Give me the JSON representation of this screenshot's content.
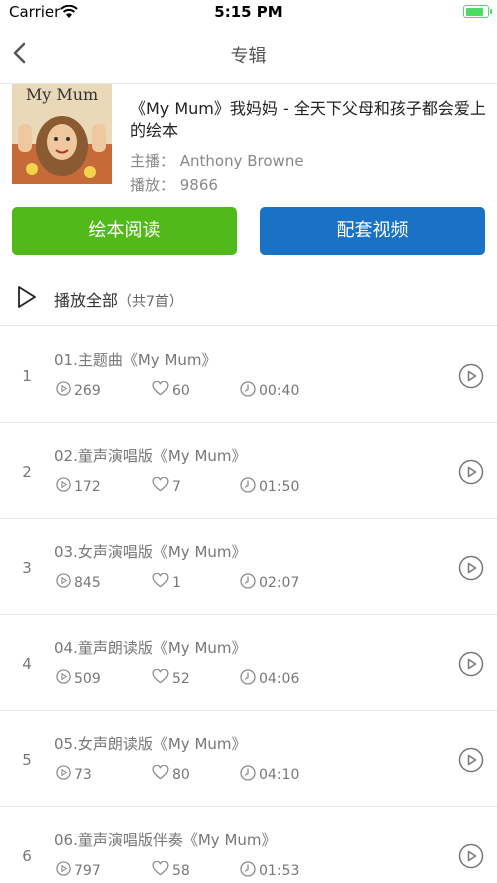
{
  "status_bar": {
    "carrier": "Carrier",
    "time": "5:15 PM"
  },
  "nav": {
    "title": "专辑",
    "back_icon": "chevron-left-icon"
  },
  "album": {
    "cover_text": "My Mum",
    "title": "《My Mum》我妈妈 - 全天下父母和孩子都会爱上的绘本",
    "host": "主播：  Anthony Browne",
    "plays": "播放：  9866"
  },
  "buttons": {
    "read": "绘本阅读",
    "video": "配套视频"
  },
  "play_all": {
    "label": "播放全部",
    "count": "（共7首）"
  },
  "tracks": [
    {
      "num": "1",
      "name": "01.主题曲《My Mum》",
      "plays": "269",
      "likes": "60",
      "duration": "00:40"
    },
    {
      "num": "2",
      "name": "02.童声演唱版《My Mum》",
      "plays": "172",
      "likes": "7",
      "duration": "01:50"
    },
    {
      "num": "3",
      "name": "03.女声演唱版《My Mum》",
      "plays": "845",
      "likes": "1",
      "duration": "02:07"
    },
    {
      "num": "4",
      "name": "04.童声朗读版《My Mum》",
      "plays": "509",
      "likes": "52",
      "duration": "04:06"
    },
    {
      "num": "5",
      "name": "05.女声朗读版《My Mum》",
      "plays": "73",
      "likes": "80",
      "duration": "04:10"
    },
    {
      "num": "6",
      "name": "06.童声演唱版伴奏《My Mum》",
      "plays": "797",
      "likes": "58",
      "duration": "01:53"
    }
  ],
  "colors": {
    "green": "#52b91a",
    "blue": "#1a72c7",
    "battery": "#4cd964"
  }
}
